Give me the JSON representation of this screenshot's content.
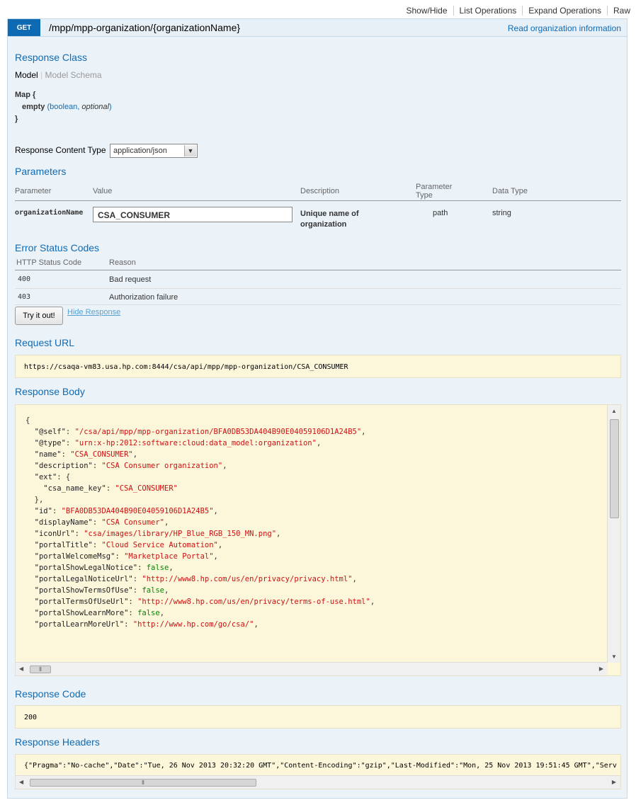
{
  "top_nav": [
    "Show/Hide",
    "List Operations",
    "Expand Operations",
    "Raw"
  ],
  "operation": {
    "method": "GET",
    "path": "/mpp/mpp-organization/{organizationName}",
    "summary": "Read organization information"
  },
  "response_class": {
    "title": "Response Class",
    "tabs": [
      "Model",
      "Model Schema"
    ],
    "model_name": "Map {",
    "field_name": "empty",
    "field_type_prefix": "(",
    "field_type": "boolean",
    "field_type_sep": ", ",
    "field_optional": "optional",
    "field_type_suffix": ")",
    "model_close": "}"
  },
  "response_content_type": {
    "label": "Response Content Type",
    "selected": "application/json"
  },
  "parameters": {
    "title": "Parameters",
    "headers": [
      "Parameter",
      "Value",
      "Description",
      "Parameter Type",
      "Data Type"
    ],
    "row": {
      "name": "organizationName",
      "value": "CSA_CONSUMER",
      "description": "Unique name of organization",
      "param_type": "path",
      "data_type": "string"
    }
  },
  "error_codes": {
    "title": "Error Status Codes",
    "headers": [
      "HTTP Status Code",
      "Reason"
    ],
    "rows": [
      {
        "code": "400",
        "reason": "Bad request"
      },
      {
        "code": "403",
        "reason": "Authorization failure"
      }
    ]
  },
  "actions": {
    "try_label": "Try it out!",
    "hide_label": "Hide Response"
  },
  "request_url": {
    "title": "Request URL",
    "value": "https://csaqa-vm83.usa.hp.com:8444/csa/api/mpp/mpp-organization/CSA_CONSUMER"
  },
  "response_body": {
    "title": "Response Body",
    "lines": [
      "{",
      "  \"@self\": \"/csa/api/mpp/mpp-organization/BFA0DB53DA404B90E04059106D1A24B5\",",
      "  \"@type\": \"urn:x-hp:2012:software:cloud:data_model:organization\",",
      "  \"name\": \"CSA_CONSUMER\",",
      "  \"description\": \"CSA Consumer organization\",",
      "  \"ext\": {",
      "    \"csa_name_key\": \"CSA_CONSUMER\"",
      "  },",
      "  \"id\": \"BFA0DB53DA404B90E04059106D1A24B5\",",
      "  \"displayName\": \"CSA Consumer\",",
      "  \"iconUrl\": \"csa/images/library/HP_Blue_RGB_150_MN.png\",",
      "  \"portalTitle\": \"Cloud Service Automation\",",
      "  \"portalWelcomeMsg\": \"Marketplace Portal\",",
      "  \"portalShowLegalNotice\": false,",
      "  \"portalLegalNoticeUrl\": \"http://www8.hp.com/us/en/privacy/privacy.html\",",
      "  \"portalShowTermsOfUse\": false,",
      "  \"portalTermsOfUseUrl\": \"http://www8.hp.com/us/en/privacy/terms-of-use.html\",",
      "  \"portalShowLearnMore\": false,",
      "  \"portalLearnMoreUrl\": \"http://www.hp.com/go/csa/\","
    ]
  },
  "response_code": {
    "title": "Response Code",
    "value": "200"
  },
  "response_headers": {
    "title": "Response Headers",
    "value": "{\"Pragma\":\"No-cache\",\"Date\":\"Tue, 26 Nov 2013 20:32:20 GMT\",\"Content-Encoding\":\"gzip\",\"Last-Modified\":\"Mon, 25 Nov 2013 19:51:45 GMT\",\"Serv"
  },
  "colors": {
    "get_method": "#0f6ab4",
    "heading": "#0f6ab4",
    "panel_bg": "#ebf3f9",
    "box_bg": "#fcf6db"
  }
}
